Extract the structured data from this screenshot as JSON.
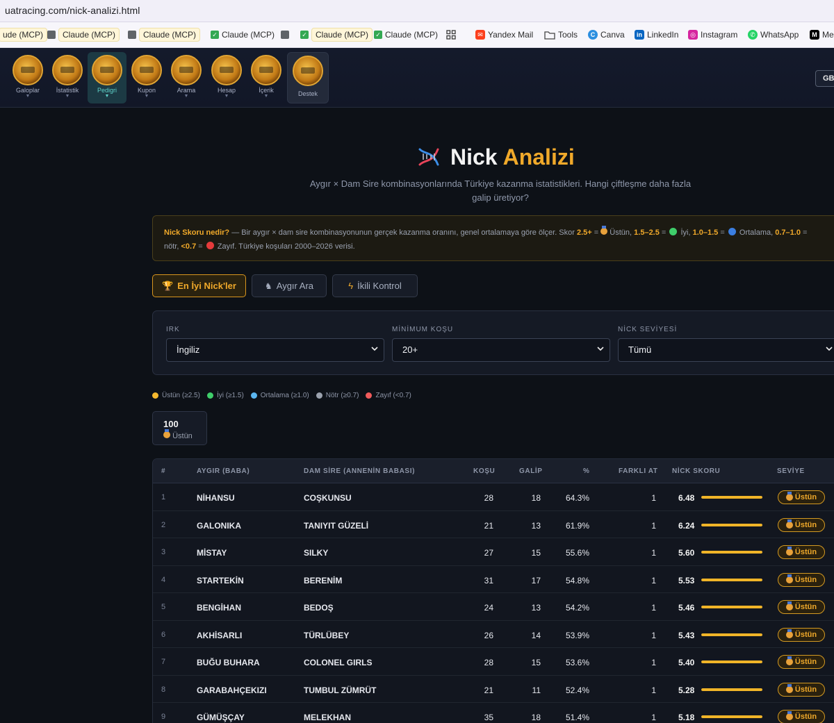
{
  "browser": {
    "url": "uatracing.com/nick-analizi.html",
    "bookmarks": [
      {
        "label": "ude (MCP)",
        "icon": "none-icon"
      },
      {
        "label": "Claude (MCP)",
        "icon": "square-icon"
      },
      {
        "label": "Claude (MCP)",
        "icon": "square-icon"
      },
      {
        "label": "Claude (MCP)",
        "icon": "check-icon"
      },
      {
        "label": "Claude (MCP)",
        "icon": "square-icon"
      },
      {
        "label": "Claude (MCP)",
        "icon": "check-icon"
      },
      {
        "label": "Claude (MCP)",
        "icon": "check-icon"
      },
      {
        "label": "Yandex Mail",
        "icon": "mail-icon"
      },
      {
        "label": "Tools",
        "icon": "folder-icon"
      },
      {
        "label": "Canva",
        "icon": "canva-icon"
      },
      {
        "label": "LinkedIn",
        "icon": "linkedin-icon"
      },
      {
        "label": "Instagram",
        "icon": "instagram-icon"
      },
      {
        "label": "WhatsApp",
        "icon": "whatsapp-icon"
      },
      {
        "label": "Me",
        "icon": "medium-icon"
      }
    ]
  },
  "nav": {
    "items": [
      {
        "label": "Galoplar"
      },
      {
        "label": "İstatistik"
      },
      {
        "label": "Pedigri"
      },
      {
        "label": "Kupon"
      },
      {
        "label": "Arama"
      },
      {
        "label": "Hesap"
      },
      {
        "label": "İçerik"
      },
      {
        "label": "Destek"
      }
    ],
    "lang": "GB"
  },
  "header": {
    "title_main": "Nick",
    "title_accent": "Analizi",
    "subtitle_line1": "Aygır × Dam Sire kombinasyonlarında Türkiye kazanma istatistikleri. Hangi çiftleşme daha fazla",
    "subtitle_line2": "galip üretiyor?"
  },
  "info": {
    "q": "Nick Skoru nedir?",
    "text1": " — Bir aygır × dam sire kombinasyonunun gerçek kazanma oranını, genel ortalamaya göre ölçer. Skor ",
    "r1": "2.5+",
    "l1": " Üstün, ",
    "r2": "1.5–2.5",
    "l2": " İyi, ",
    "r3": "1.0–1.5",
    "l3": " Ortalama, ",
    "r4": "0.7–1.0",
    "eq": " =",
    "l4": "nötr, ",
    "r5": "<0.7",
    "l5": " Zayıf. Türkiye koşuları 2000–2026 verisi."
  },
  "tabs": [
    {
      "label": "En İyi Nick'ler",
      "icon": "trophy-icon"
    },
    {
      "label": "Aygır Ara",
      "icon": "horse-icon"
    },
    {
      "label": "İkili Kontrol",
      "icon": "bolt-icon"
    }
  ],
  "filters": {
    "irk_label": "IRK",
    "irk_value": "İngiliz",
    "min_label": "MİNİMUM KOŞU",
    "min_value": "20+",
    "level_label": "NİCK SEVİYESİ",
    "level_value": "Tümü"
  },
  "legend": [
    {
      "label": "Üstün (≥2.5)",
      "color": "#f5b82e"
    },
    {
      "label": "İyi (≥1.5)",
      "color": "#3fce6a"
    },
    {
      "label": "Ortalama (≥1.0)",
      "color": "#5bb6f0"
    },
    {
      "label": "Nötr (≥0.7)",
      "color": "#9aa1ad"
    },
    {
      "label": "Zayıf (<0.7)",
      "color": "#ef5b5b"
    }
  ],
  "summary": {
    "count": "100",
    "label": "Üstün"
  },
  "table": {
    "headers": {
      "idx": "#",
      "sire": "AYGIR (BABA)",
      "damsire": "DAM SİRE (ANNENİN BABASI)",
      "runs": "KOŞU",
      "wins": "GALİP",
      "pct": "%",
      "diff": "FARKLI AT",
      "score": "NİCK SKORU",
      "level": "SEVİYE"
    },
    "rows": [
      {
        "idx": "1",
        "sire": "NİHANSU",
        "damsire": "COŞKUNSU",
        "runs": "28",
        "wins": "18",
        "pct": "64.3%",
        "diff": "1",
        "score": "6.48",
        "fill": 1.0,
        "level": "Üstün"
      },
      {
        "idx": "2",
        "sire": "GALONIKA",
        "damsire": "TANIYIT GÜZELİ",
        "runs": "21",
        "wins": "13",
        "pct": "61.9%",
        "diff": "1",
        "score": "6.24",
        "fill": 1.0,
        "level": "Üstün"
      },
      {
        "idx": "3",
        "sire": "MİSTAY",
        "damsire": "SILKY",
        "runs": "27",
        "wins": "15",
        "pct": "55.6%",
        "diff": "1",
        "score": "5.60",
        "fill": 1.0,
        "level": "Üstün"
      },
      {
        "idx": "4",
        "sire": "STARTEKİN",
        "damsire": "BERENİM",
        "runs": "31",
        "wins": "17",
        "pct": "54.8%",
        "diff": "1",
        "score": "5.53",
        "fill": 1.0,
        "level": "Üstün"
      },
      {
        "idx": "5",
        "sire": "BENGİHAN",
        "damsire": "BEDOŞ",
        "runs": "24",
        "wins": "13",
        "pct": "54.2%",
        "diff": "1",
        "score": "5.46",
        "fill": 1.0,
        "level": "Üstün"
      },
      {
        "idx": "6",
        "sire": "AKHİSARLI",
        "damsire": "TÜRLÜBEY",
        "runs": "26",
        "wins": "14",
        "pct": "53.9%",
        "diff": "1",
        "score": "5.43",
        "fill": 1.0,
        "level": "Üstün"
      },
      {
        "idx": "7",
        "sire": "BUĞU BUHARA",
        "damsire": "COLONEL GIRLS",
        "runs": "28",
        "wins": "15",
        "pct": "53.6%",
        "diff": "1",
        "score": "5.40",
        "fill": 1.0,
        "level": "Üstün"
      },
      {
        "idx": "8",
        "sire": "GARABAHÇEKIZI",
        "damsire": "TUMBUL ZÜMRÜT",
        "runs": "21",
        "wins": "11",
        "pct": "52.4%",
        "diff": "1",
        "score": "5.28",
        "fill": 1.0,
        "level": "Üstün"
      },
      {
        "idx": "9",
        "sire": "GÜMÜŞÇAY",
        "damsire": "MELEKHAN",
        "runs": "35",
        "wins": "18",
        "pct": "51.4%",
        "diff": "1",
        "score": "5.18",
        "fill": 1.0,
        "level": "Üstün"
      }
    ]
  }
}
